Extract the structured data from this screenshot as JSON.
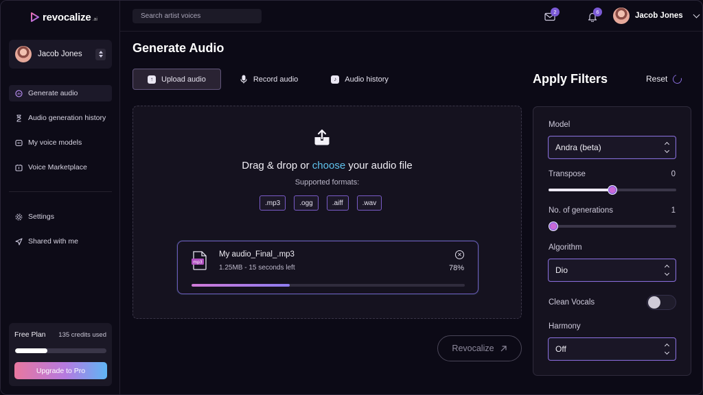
{
  "app": {
    "logo_text": "revocalize",
    "logo_suffix": ".ai"
  },
  "user": {
    "name": "Jacob Jones"
  },
  "sidebar": {
    "nav": [
      {
        "label": "Generate audio",
        "icon": "waveform-icon",
        "active": true
      },
      {
        "label": "Audio generation history",
        "icon": "hourglass-icon",
        "active": false
      },
      {
        "label": "My voice models",
        "icon": "voice-model-icon",
        "active": false
      },
      {
        "label": "Voice Marketplace",
        "icon": "marketplace-icon",
        "active": false
      }
    ],
    "secondary": [
      {
        "label": "Settings",
        "icon": "gear-icon"
      },
      {
        "label": "Shared with me",
        "icon": "send-icon"
      }
    ],
    "plan": {
      "name": "Free Plan",
      "credits": "135 credits used",
      "progress": 0.35,
      "upgrade_label": "Upgrade to Pro"
    }
  },
  "topbar": {
    "search_placeholder": "Search artist voices",
    "mail_count": "2",
    "notif_count": "6"
  },
  "main": {
    "title": "Generate Audio",
    "tabs": [
      {
        "label": "Upload audio",
        "icon": "upload-file-icon",
        "active": true
      },
      {
        "label": "Record audio",
        "icon": "microphone-icon",
        "active": false
      },
      {
        "label": "Audio history",
        "icon": "history-icon",
        "active": false
      }
    ],
    "dropzone": {
      "title_before": "Drag & drop or ",
      "title_link": "choose",
      "title_after": " your audio file",
      "formats_label": "Supported formats:",
      "formats": [
        ".mp3",
        ".ogg",
        ".aiff",
        ".wav"
      ]
    },
    "file": {
      "type_badge": "mp3",
      "name": "My audio_Final_.mp3",
      "meta": "1.25MB - 15 seconds left",
      "percent_label": "78%",
      "progress": 0.36
    },
    "submit_label": "Revocalize"
  },
  "filters": {
    "title": "Apply Filters",
    "reset_label": "Reset",
    "model": {
      "label": "Model",
      "value": "Andra (beta)"
    },
    "transpose": {
      "label": "Transpose",
      "value": "0",
      "level": 0.5
    },
    "generations": {
      "label": "No. of generations",
      "value": "1",
      "level": 0.04
    },
    "algorithm": {
      "label": "Algorithm",
      "value": "Dio"
    },
    "clean_vocals": {
      "label": "Clean Vocals",
      "on": false
    },
    "harmony": {
      "label": "Harmony",
      "value": "Off"
    }
  }
}
